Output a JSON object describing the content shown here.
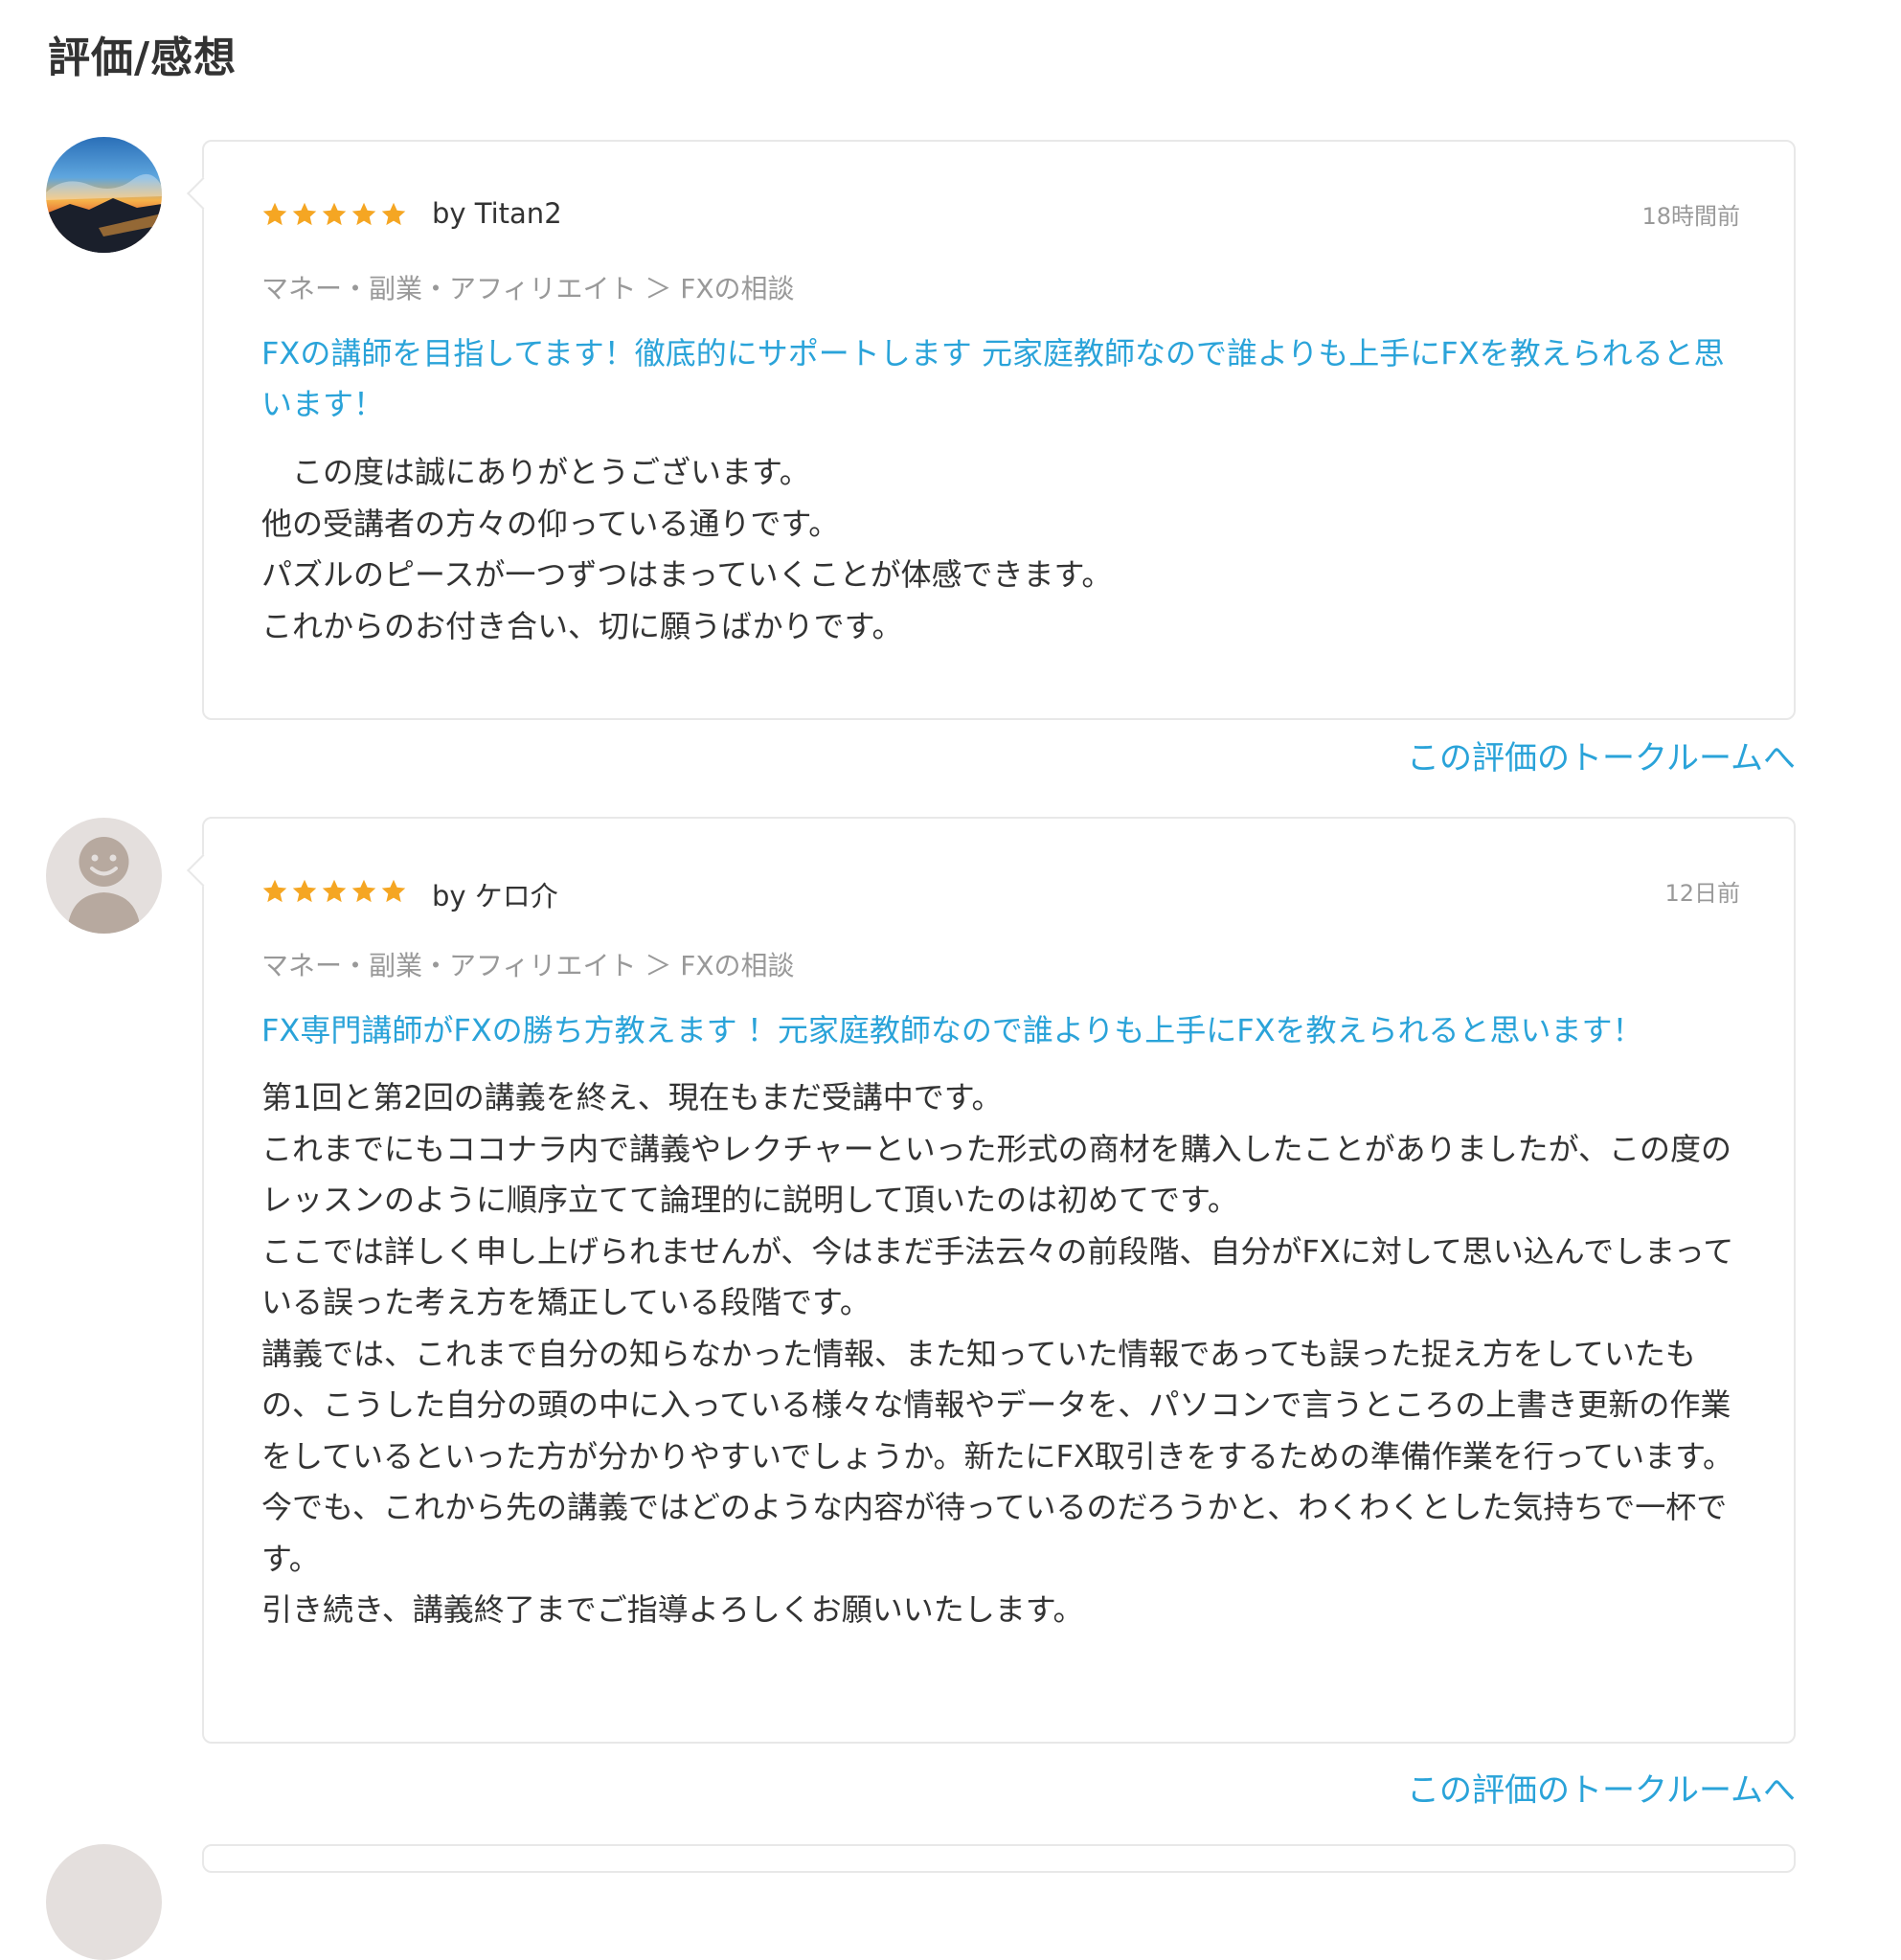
{
  "page": {
    "title": "評価/感想"
  },
  "reviews": [
    {
      "rating": 5,
      "avatar_icon": "landscape-sunset-avatar",
      "byline": "by Titan2",
      "time": "18時間前",
      "category": "マネー・副業・アフィリエイト ＞ FXの相談",
      "service_title": "FXの講師を目指してます！徹底的にサポートします 元家庭教師なので誰よりも上手にFXを教えられると思います！",
      "body": "　この度は誠にありがとうございます。\n他の受講者の方々の仰っている通りです。\nパズルのピースが一つずつはまっていくことが体感できます。\nこれからのお付き合い、切に願うばかりです。",
      "talk_link": "この評価のトークルームへ"
    },
    {
      "rating": 5,
      "avatar_icon": "default-user-avatar",
      "byline": "by ケロ介",
      "time": "12日前",
      "category": "マネー・副業・アフィリエイト ＞ FXの相談",
      "service_title": "FX専門講師がFXの勝ち方教えます ！元家庭教師なので誰よりも上手にFXを教えられると思います！",
      "body": "第1回と第2回の講義を終え、現在もまだ受講中です。\nこれまでにもココナラ内で講義やレクチャーといった形式の商材を購入したことがありましたが、この度のレッスンのように順序立てて論理的に説明して頂いたのは初めてです。\nここでは詳しく申し上げられませんが、今はまだ手法云々の前段階、自分がFXに対して思い込んでしまっている誤った考え方を矯正している段階です。\n講義では、これまで自分の知らなかった情報、また知っていた情報であっても誤った捉え方をしていたもの、こうした自分の頭の中に入っている様々な情報やデータを、パソコンで言うところの上書き更新の作業をしているといった方が分かりやすいでしょうか。新たにFX取引きをするための準備作業を行っています。\n今でも、これから先の講義ではどのような内容が待っているのだろうかと、わくわくとした気持ちで一杯です。\n引き続き、講義終了までご指導よろしくお願いいたします。",
      "talk_link": "この評価のトークルームへ"
    }
  ],
  "colors": {
    "star": "#f5a623",
    "link": "#2aa3d9",
    "muted": "#999999",
    "border": "#e8e8e8"
  }
}
